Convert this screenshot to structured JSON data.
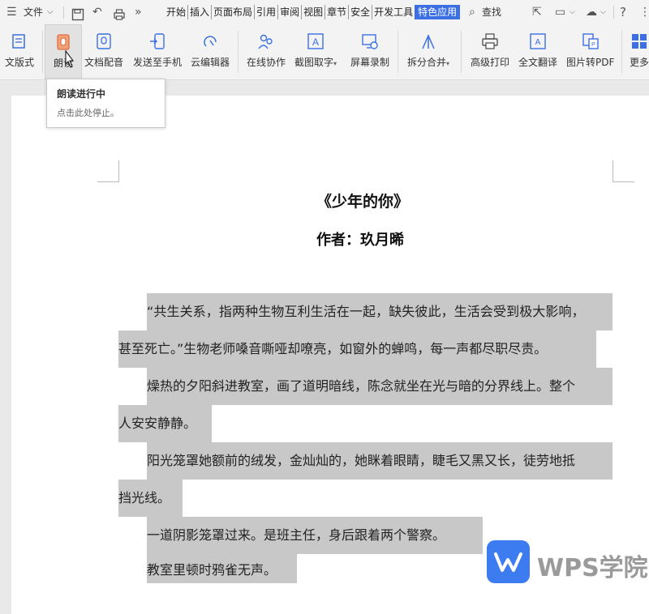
{
  "menubar": {
    "menu_icon": "hamburger-icon",
    "file_label": "文件",
    "tabs": [
      "开始",
      "插入",
      "页面布局",
      "引用",
      "审阅",
      "视图",
      "章节",
      "安全",
      "开发工具"
    ],
    "active_tab": "特色应用",
    "search_label": "查找"
  },
  "toolbar": {
    "items": [
      {
        "label": "文版式",
        "icon": "layout-icon"
      },
      {
        "label": "朗读",
        "icon": "read-aloud-icon"
      },
      {
        "label": "文档配音",
        "icon": "microphone-icon"
      },
      {
        "label": "发送至手机",
        "icon": "send-to-phone-icon"
      },
      {
        "label": "云编辑器",
        "icon": "cloud-editor-icon"
      },
      {
        "label": "在线协作",
        "icon": "collaboration-icon"
      },
      {
        "label": "截图取字",
        "icon": "ocr-icon"
      },
      {
        "label": "屏幕录制",
        "icon": "screen-record-icon"
      },
      {
        "label": "拆分合并",
        "icon": "split-merge-icon"
      },
      {
        "label": "高级打印",
        "icon": "print-icon"
      },
      {
        "label": "全文翻译",
        "icon": "translate-icon"
      },
      {
        "label": "图片转PDF",
        "icon": "image-to-pdf-icon"
      },
      {
        "label": "更多",
        "icon": "more-icon"
      }
    ]
  },
  "tooltip": {
    "title": "朗读进行中",
    "desc": "点击此处停止。"
  },
  "document": {
    "title": "《少年的你》",
    "author": "作者：玖月晞",
    "lines": [
      "“共生关系，指两种生物互利生活在一起，缺失彼此，生活会受到极大影响，",
      "甚至死亡。”生物老师嗓音嘶哑却嘹亮，如窗外的蝉鸣，每一声都尽职尽责。",
      "燥热的夕阳斜进教室，画了道明暗线，陈念就坐在光与暗的分界线上。整个",
      "人安安静静。",
      "阳光笼罩她额前的绒发，金灿灿的，她眯着眼睛，睫毛又黑又长，徒劳地抵",
      "挡光线。",
      "一道阴影笼罩过来。是班主任，身后跟着两个警察。",
      "教室里顿时鸦雀无声。"
    ]
  },
  "watermark": {
    "logo_icon": "wps-logo-icon",
    "text": "WPS学院"
  },
  "colors": {
    "accent": "#3b6fe3",
    "highlight": "#c8c8c8",
    "logo": "#3d7bf0"
  }
}
